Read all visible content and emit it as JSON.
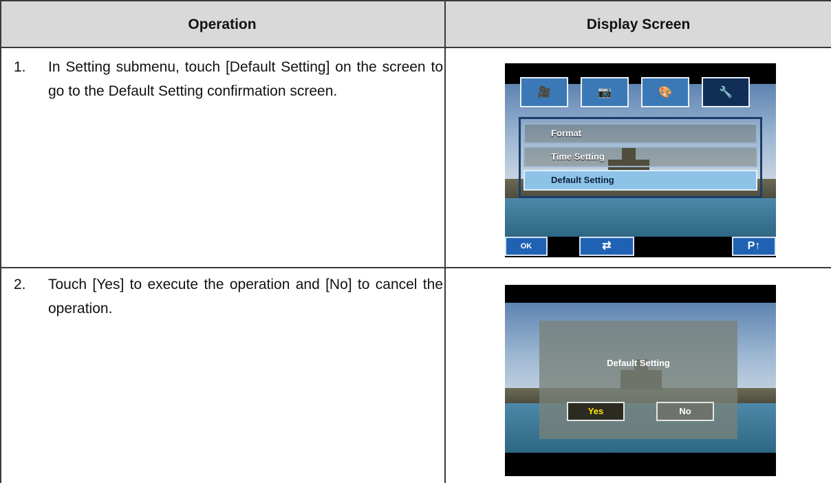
{
  "table": {
    "col_operation": "Operation",
    "col_display": "Display Screen"
  },
  "rows": [
    {
      "num": "1.",
      "text": "In Setting submenu, touch [Default Setting] on the screen to go to the Default Setting confirmation screen."
    },
    {
      "num": "2.",
      "text": "Touch [Yes] to execute the operation and [No] to cancel the operation."
    }
  ],
  "screen1": {
    "tabs": [
      {
        "icon": "camcorder-icon",
        "glyph": "🎥"
      },
      {
        "icon": "camera-icon",
        "glyph": "📷"
      },
      {
        "icon": "palette-icon",
        "glyph": "🎨"
      },
      {
        "icon": "settings-tools-icon",
        "glyph": "🔧"
      }
    ],
    "menu_items": [
      "Format",
      "Time Setting",
      "Default Setting"
    ],
    "selected_item": "Default Setting",
    "ok_label": "OK",
    "back_glyph": "⇄",
    "page_label": "P↑"
  },
  "screen2": {
    "title": "Default Setting",
    "yes_label": "Yes",
    "no_label": "No"
  },
  "colors": {
    "tab_blue": "#3b79b6",
    "selected_item": "#8ec3e8",
    "yes_text": "#ffe600"
  }
}
